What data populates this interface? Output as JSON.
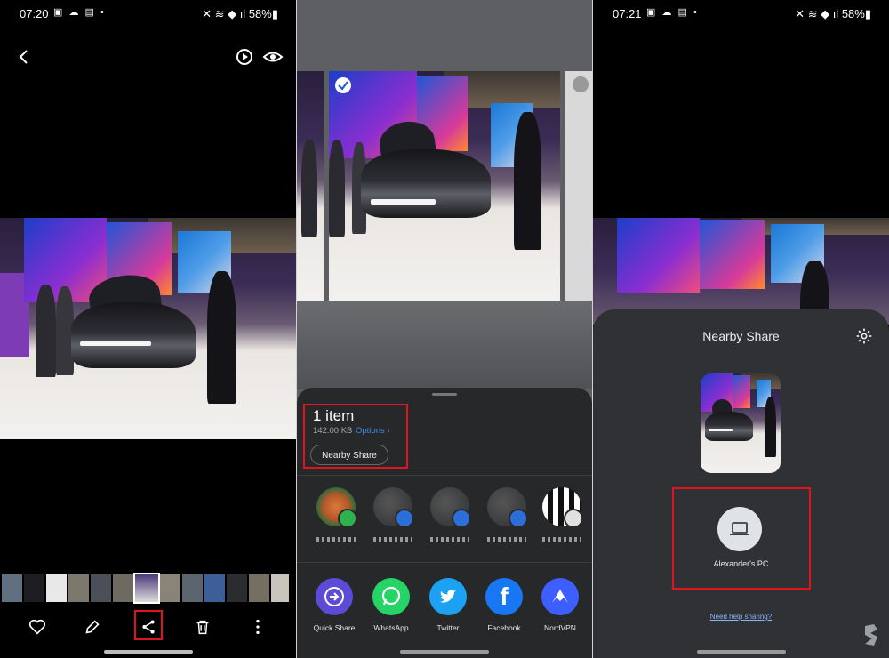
{
  "panel1": {
    "status": {
      "time": "07:20",
      "icons": "▣ ☁ ▤ •",
      "battery": "58%"
    },
    "top_icons": [
      "back-icon",
      "motion-photo-icon",
      "eye-icon"
    ],
    "bottom_icons": [
      "heart-icon",
      "edit-icon",
      "share-icon",
      "trash-icon",
      "more-icon"
    ]
  },
  "panel2": {
    "items_count": "1 item",
    "size": "142.00 KB",
    "options_label": "Options",
    "nearby_share_label": "Nearby Share",
    "apps": [
      {
        "label": "Quick Share",
        "color": "#5b4bd6",
        "icon": "arrow-right-icon"
      },
      {
        "label": "WhatsApp",
        "color": "#25d366",
        "icon": "whatsapp-icon"
      },
      {
        "label": "Twitter",
        "color": "#1da1f2",
        "icon": "twitter-icon"
      },
      {
        "label": "Facebook",
        "color": "#1877f2",
        "icon": "facebook-icon"
      },
      {
        "label": "NordVPN",
        "color": "#3e5fff",
        "icon": "nordvpn-icon"
      }
    ]
  },
  "panel3": {
    "status": {
      "time": "07:21",
      "icons": "▣ ☁ ▤ •",
      "battery": "58%"
    },
    "title": "Nearby Share",
    "device_name": "Alexander's PC",
    "help_link": "Need help sharing?"
  },
  "colors": {
    "highlight": "#e0141e",
    "link_blue": "#3d8cf0"
  }
}
